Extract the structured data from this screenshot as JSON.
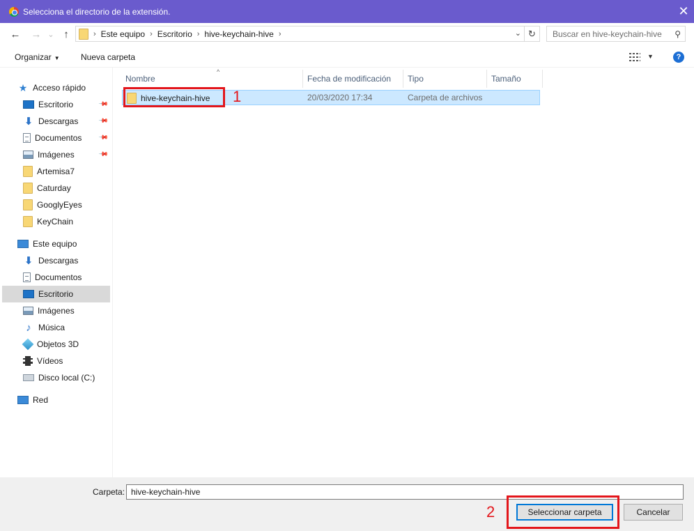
{
  "window": {
    "title": "Selecciona el directorio de la extensión.",
    "close_glyph": "✕"
  },
  "navbar": {
    "back_glyph": "←",
    "forward_glyph": "→",
    "recent_glyph": "⌄",
    "up_glyph": "↑",
    "breadcrumb": [
      "Este equipo",
      "Escritorio",
      "hive-keychain-hive"
    ],
    "crumb_separator": "›",
    "dropdown_glyph": "⌄",
    "refresh_glyph": "↻",
    "search_placeholder": "Buscar en hive-keychain-hive",
    "search_glyph": "⚲"
  },
  "toolbar": {
    "organize": "Organizar",
    "organize_caret": "▼",
    "new_folder": "Nueva carpeta",
    "view_caret": "▼",
    "help_glyph": "?"
  },
  "sidebar": {
    "pin_glyph": "📌",
    "items": [
      {
        "label": "Acceso rápido",
        "icon": "star-icon"
      },
      {
        "label": "Escritorio",
        "icon": "desktop-icon",
        "pinned": true
      },
      {
        "label": "Descargas",
        "icon": "download-icon",
        "pinned": true
      },
      {
        "label": "Documentos",
        "icon": "document-icon",
        "pinned": true
      },
      {
        "label": "Imágenes",
        "icon": "image-icon",
        "pinned": true
      },
      {
        "label": "Artemisa7",
        "icon": "folder-icon"
      },
      {
        "label": "Caturday",
        "icon": "folder-icon"
      },
      {
        "label": "GooglyEyes",
        "icon": "folder-icon"
      },
      {
        "label": "KeyChain",
        "icon": "folder-icon"
      },
      {
        "label": "Este equipo",
        "icon": "computer-icon"
      },
      {
        "label": "Descargas",
        "icon": "download-icon"
      },
      {
        "label": "Documentos",
        "icon": "document-icon"
      },
      {
        "label": "Escritorio",
        "icon": "desktop-icon",
        "selected": true
      },
      {
        "label": "Imágenes",
        "icon": "image-icon"
      },
      {
        "label": "Música",
        "icon": "music-icon"
      },
      {
        "label": "Objetos 3D",
        "icon": "cube-icon"
      },
      {
        "label": "Vídeos",
        "icon": "video-icon"
      },
      {
        "label": "Disco local (C:)",
        "icon": "disk-icon"
      },
      {
        "label": "Red",
        "icon": "network-icon"
      }
    ],
    "glyphs": {
      "star": "★",
      "download": "⬇",
      "music": "♪"
    }
  },
  "columns": [
    "Nombre",
    "Fecha de modificación",
    "Tipo",
    "Tamaño"
  ],
  "sort_glyph": "^",
  "files": [
    {
      "name": "hive-keychain-hive",
      "modified": "20/03/2020 17:34",
      "type": "Carpeta de archivos",
      "size": ""
    }
  ],
  "annotations": {
    "step1": "1",
    "step2": "2",
    "color": "#e3161b"
  },
  "bottom": {
    "folder_label": "Carpeta:",
    "folder_value": "hive-keychain-hive",
    "select_button": "Seleccionar carpeta",
    "cancel_button": "Cancelar"
  },
  "colors": {
    "titlebar": "#6a5bcd",
    "selection": "#cce8ff",
    "accent": "#0078d7"
  }
}
